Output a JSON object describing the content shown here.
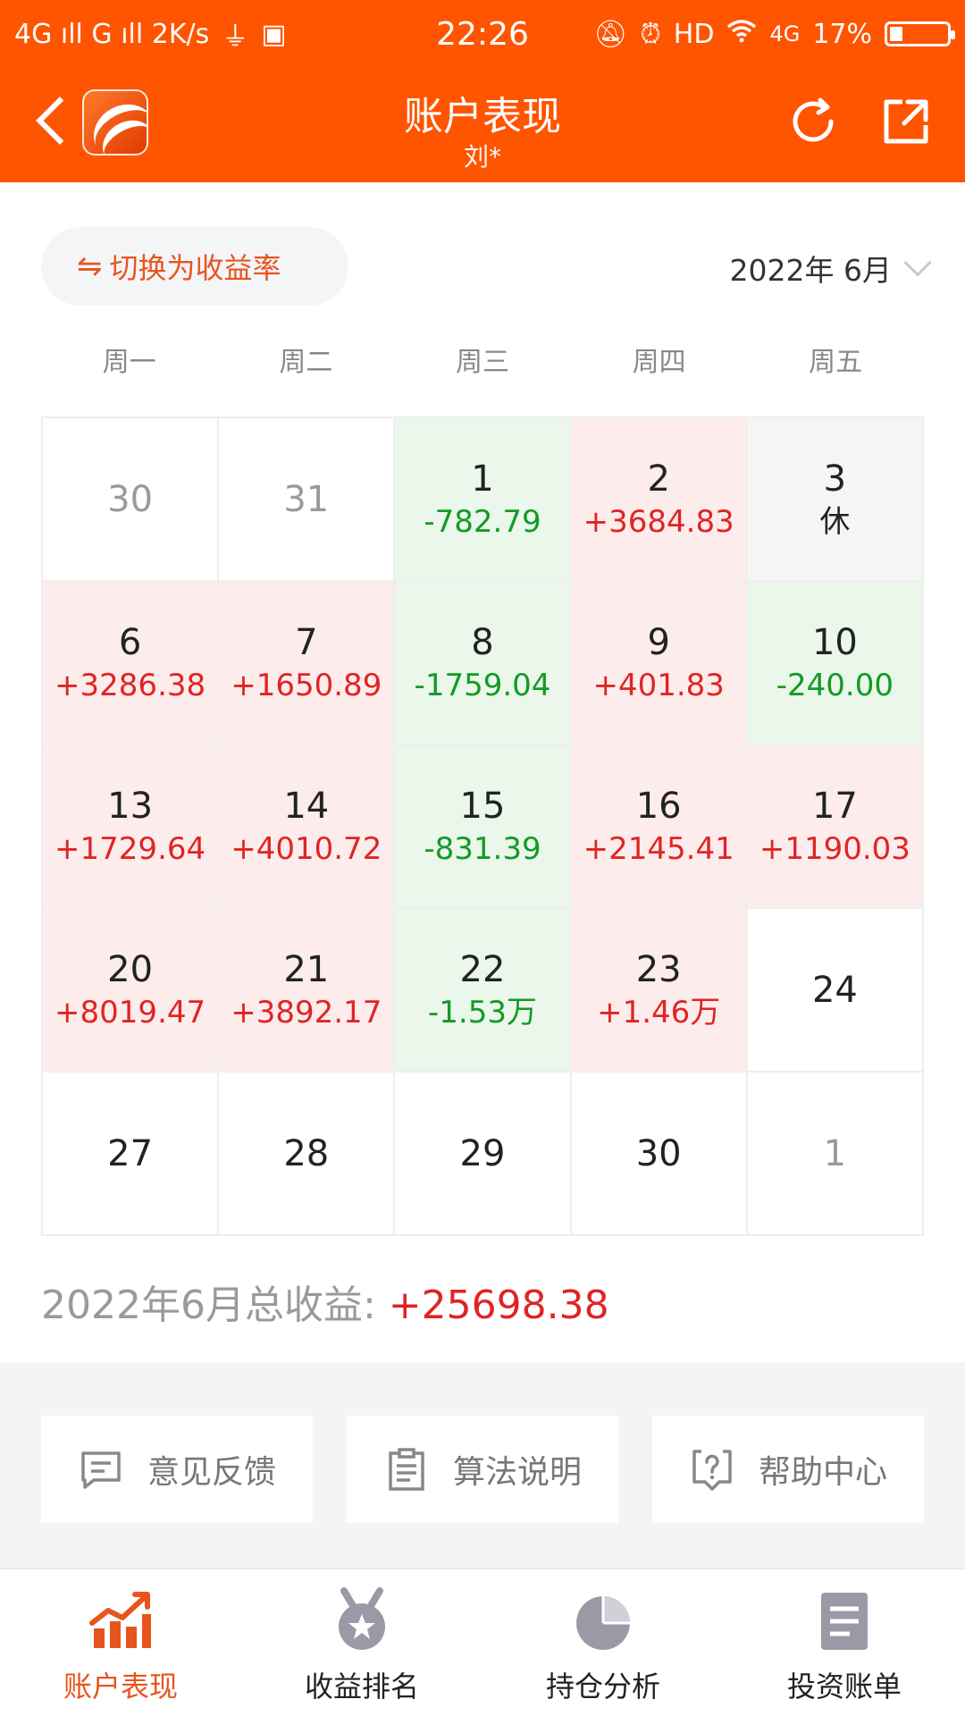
{
  "status_bar": {
    "left": "4G ıll G ıll 2K/s",
    "time": "22:26",
    "right_hd": "HD",
    "right_4g": "4G",
    "battery": "17%"
  },
  "header": {
    "title": "账户表现",
    "subtitle": "刘*"
  },
  "toolbar": {
    "switch_label": "切换为收益率",
    "switch_icon": "⇋",
    "month": "2022年 6月"
  },
  "weekdays": [
    "周一",
    "周二",
    "周三",
    "周四",
    "周五"
  ],
  "calendar": [
    [
      {
        "day": "30",
        "value": ""
      },
      {
        "day": "31",
        "value": ""
      },
      {
        "day": "1",
        "value": "-782.79"
      },
      {
        "day": "2",
        "value": "+3684.83"
      },
      {
        "day": "3",
        "value": "休"
      }
    ],
    [
      {
        "day": "6",
        "value": "+3286.38"
      },
      {
        "day": "7",
        "value": "+1650.89"
      },
      {
        "day": "8",
        "value": "-1759.04"
      },
      {
        "day": "9",
        "value": "+401.83"
      },
      {
        "day": "10",
        "value": "-240.00"
      }
    ],
    [
      {
        "day": "13",
        "value": "+1729.64"
      },
      {
        "day": "14",
        "value": "+4010.72"
      },
      {
        "day": "15",
        "value": "-831.39"
      },
      {
        "day": "16",
        "value": "+2145.41"
      },
      {
        "day": "17",
        "value": "+1190.03"
      }
    ],
    [
      {
        "day": "20",
        "value": "+8019.47"
      },
      {
        "day": "21",
        "value": "+3892.17"
      },
      {
        "day": "22",
        "value": "-1.53万"
      },
      {
        "day": "23",
        "value": "+1.46万"
      },
      {
        "day": "24",
        "value": ""
      }
    ],
    [
      {
        "day": "27",
        "value": ""
      },
      {
        "day": "28",
        "value": ""
      },
      {
        "day": "29",
        "value": ""
      },
      {
        "day": "30",
        "value": ""
      },
      {
        "day": "1",
        "value": ""
      }
    ]
  ],
  "summary": {
    "label": "2022年6月总收益: ",
    "amount": "+25698.38"
  },
  "actions": [
    {
      "label": "意见反馈",
      "icon": "message-icon"
    },
    {
      "label": "算法说明",
      "icon": "clipboard-icon"
    },
    {
      "label": "帮助中心",
      "icon": "help-icon"
    }
  ],
  "tabs": [
    {
      "label": "账户表现",
      "icon": "trend-chart-icon",
      "active": true
    },
    {
      "label": "收益排名",
      "icon": "medal-icon",
      "active": false
    },
    {
      "label": "持仓分析",
      "icon": "pie-chart-icon",
      "active": false
    },
    {
      "label": "投资账单",
      "icon": "document-icon",
      "active": false
    }
  ],
  "colors": {
    "brand": "#FF5400",
    "gain": "#E02424",
    "loss": "#139A26",
    "gain_bg": "#FDECEC",
    "loss_bg": "#EAF7EA"
  }
}
